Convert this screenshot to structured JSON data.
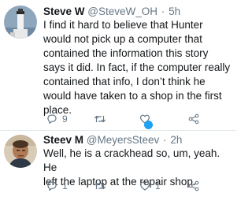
{
  "tweets": [
    {
      "name": "Steve W",
      "handle": "@SteveW_OH",
      "separator": "·",
      "time": "5h",
      "lines": [
        "I find it hard to believe that Hunter",
        "would not pick up a computer that",
        "contained the information this story",
        "says it did. In fact, if the computer really",
        "contained that info, I don’t think he",
        "would have taken to a shop in the first",
        "place."
      ],
      "reply_count": "9",
      "retweet_count": "",
      "like_count": "",
      "avatar_icon": "lighthouse-photo"
    },
    {
      "name": "Steev M",
      "handle": "@MeyersSteev",
      "separator": "·",
      "time": "2h",
      "lines": [
        "Well, he is a crackhead so, um, yeah. He",
        "left the laptop at the repair shop."
      ],
      "reply_count": "1",
      "retweet_count": "",
      "like_count": "1",
      "avatar_icon": "person-photo"
    }
  ],
  "colors": {
    "text": "#14171a",
    "muted": "#657786",
    "divider": "#e1e8ed",
    "accent": "#1da1f2"
  }
}
